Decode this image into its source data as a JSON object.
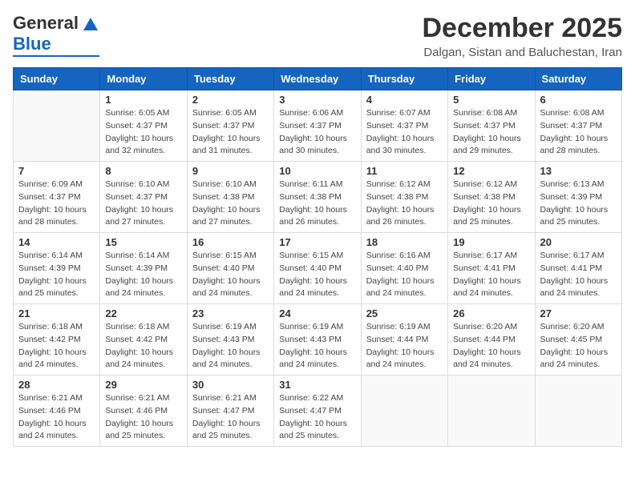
{
  "header": {
    "title": "December 2025",
    "location": "Dalgan, Sistan and Baluchestan, Iran"
  },
  "days_of_week": [
    "Sunday",
    "Monday",
    "Tuesday",
    "Wednesday",
    "Thursday",
    "Friday",
    "Saturday"
  ],
  "weeks": [
    [
      {
        "day": "",
        "info": ""
      },
      {
        "day": "1",
        "info": "Sunrise: 6:05 AM\nSunset: 4:37 PM\nDaylight: 10 hours\nand 32 minutes."
      },
      {
        "day": "2",
        "info": "Sunrise: 6:05 AM\nSunset: 4:37 PM\nDaylight: 10 hours\nand 31 minutes."
      },
      {
        "day": "3",
        "info": "Sunrise: 6:06 AM\nSunset: 4:37 PM\nDaylight: 10 hours\nand 30 minutes."
      },
      {
        "day": "4",
        "info": "Sunrise: 6:07 AM\nSunset: 4:37 PM\nDaylight: 10 hours\nand 30 minutes."
      },
      {
        "day": "5",
        "info": "Sunrise: 6:08 AM\nSunset: 4:37 PM\nDaylight: 10 hours\nand 29 minutes."
      },
      {
        "day": "6",
        "info": "Sunrise: 6:08 AM\nSunset: 4:37 PM\nDaylight: 10 hours\nand 28 minutes."
      }
    ],
    [
      {
        "day": "7",
        "info": "Sunrise: 6:09 AM\nSunset: 4:37 PM\nDaylight: 10 hours\nand 28 minutes."
      },
      {
        "day": "8",
        "info": "Sunrise: 6:10 AM\nSunset: 4:37 PM\nDaylight: 10 hours\nand 27 minutes."
      },
      {
        "day": "9",
        "info": "Sunrise: 6:10 AM\nSunset: 4:38 PM\nDaylight: 10 hours\nand 27 minutes."
      },
      {
        "day": "10",
        "info": "Sunrise: 6:11 AM\nSunset: 4:38 PM\nDaylight: 10 hours\nand 26 minutes."
      },
      {
        "day": "11",
        "info": "Sunrise: 6:12 AM\nSunset: 4:38 PM\nDaylight: 10 hours\nand 26 minutes."
      },
      {
        "day": "12",
        "info": "Sunrise: 6:12 AM\nSunset: 4:38 PM\nDaylight: 10 hours\nand 25 minutes."
      },
      {
        "day": "13",
        "info": "Sunrise: 6:13 AM\nSunset: 4:39 PM\nDaylight: 10 hours\nand 25 minutes."
      }
    ],
    [
      {
        "day": "14",
        "info": "Sunrise: 6:14 AM\nSunset: 4:39 PM\nDaylight: 10 hours\nand 25 minutes."
      },
      {
        "day": "15",
        "info": "Sunrise: 6:14 AM\nSunset: 4:39 PM\nDaylight: 10 hours\nand 24 minutes."
      },
      {
        "day": "16",
        "info": "Sunrise: 6:15 AM\nSunset: 4:40 PM\nDaylight: 10 hours\nand 24 minutes."
      },
      {
        "day": "17",
        "info": "Sunrise: 6:15 AM\nSunset: 4:40 PM\nDaylight: 10 hours\nand 24 minutes."
      },
      {
        "day": "18",
        "info": "Sunrise: 6:16 AM\nSunset: 4:40 PM\nDaylight: 10 hours\nand 24 minutes."
      },
      {
        "day": "19",
        "info": "Sunrise: 6:17 AM\nSunset: 4:41 PM\nDaylight: 10 hours\nand 24 minutes."
      },
      {
        "day": "20",
        "info": "Sunrise: 6:17 AM\nSunset: 4:41 PM\nDaylight: 10 hours\nand 24 minutes."
      }
    ],
    [
      {
        "day": "21",
        "info": "Sunrise: 6:18 AM\nSunset: 4:42 PM\nDaylight: 10 hours\nand 24 minutes."
      },
      {
        "day": "22",
        "info": "Sunrise: 6:18 AM\nSunset: 4:42 PM\nDaylight: 10 hours\nand 24 minutes."
      },
      {
        "day": "23",
        "info": "Sunrise: 6:19 AM\nSunset: 4:43 PM\nDaylight: 10 hours\nand 24 minutes."
      },
      {
        "day": "24",
        "info": "Sunrise: 6:19 AM\nSunset: 4:43 PM\nDaylight: 10 hours\nand 24 minutes."
      },
      {
        "day": "25",
        "info": "Sunrise: 6:19 AM\nSunset: 4:44 PM\nDaylight: 10 hours\nand 24 minutes."
      },
      {
        "day": "26",
        "info": "Sunrise: 6:20 AM\nSunset: 4:44 PM\nDaylight: 10 hours\nand 24 minutes."
      },
      {
        "day": "27",
        "info": "Sunrise: 6:20 AM\nSunset: 4:45 PM\nDaylight: 10 hours\nand 24 minutes."
      }
    ],
    [
      {
        "day": "28",
        "info": "Sunrise: 6:21 AM\nSunset: 4:46 PM\nDaylight: 10 hours\nand 24 minutes."
      },
      {
        "day": "29",
        "info": "Sunrise: 6:21 AM\nSunset: 4:46 PM\nDaylight: 10 hours\nand 25 minutes."
      },
      {
        "day": "30",
        "info": "Sunrise: 6:21 AM\nSunset: 4:47 PM\nDaylight: 10 hours\nand 25 minutes."
      },
      {
        "day": "31",
        "info": "Sunrise: 6:22 AM\nSunset: 4:47 PM\nDaylight: 10 hours\nand 25 minutes."
      },
      {
        "day": "",
        "info": ""
      },
      {
        "day": "",
        "info": ""
      },
      {
        "day": "",
        "info": ""
      }
    ]
  ],
  "logo": {
    "general": "General",
    "blue": "Blue"
  }
}
